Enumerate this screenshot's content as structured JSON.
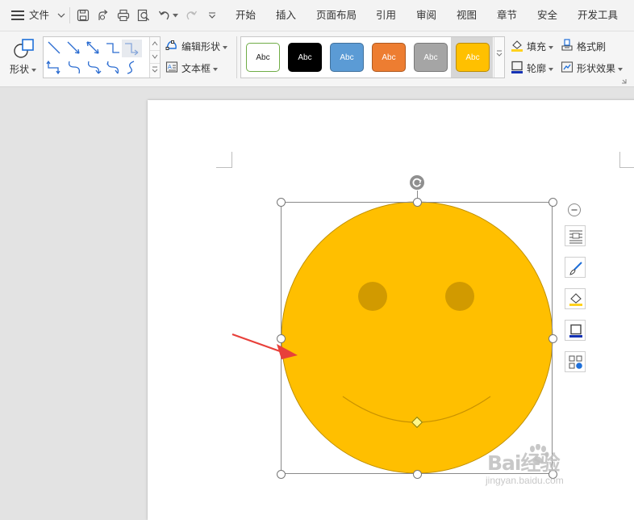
{
  "menubar": {
    "file_label": "文件",
    "tabs": [
      "开始",
      "插入",
      "页面布局",
      "引用",
      "审阅",
      "视图",
      "章节",
      "安全",
      "开发工具"
    ]
  },
  "ribbon": {
    "shapes_label": "形状",
    "edit_shape_label": "编辑形状",
    "text_box_label": "文本框",
    "style_presets": [
      {
        "label": "Abc",
        "fill": "#ffffff",
        "border": "#70ad47",
        "text": "#222222"
      },
      {
        "label": "Abc",
        "fill": "#000000",
        "border": "#000000",
        "text": "#ffffff"
      },
      {
        "label": "Abc",
        "fill": "#5b9bd5",
        "border": "#41719c",
        "text": "#ffffff"
      },
      {
        "label": "Abc",
        "fill": "#ed7d31",
        "border": "#ae5a21",
        "text": "#ffffff"
      },
      {
        "label": "Abc",
        "fill": "#a5a5a5",
        "border": "#787878",
        "text": "#ffffff"
      },
      {
        "label": "Abc",
        "fill": "#ffc000",
        "border": "#bc8c00",
        "text": "#ffffff",
        "selected": true
      }
    ],
    "fill_label": "填充",
    "outline_label": "轮廓",
    "format_painter_label": "格式刷",
    "shape_effects_label": "形状效果"
  },
  "shape": {
    "type": "smiley",
    "fill": "#ffbf00",
    "stroke": "#bf8f00",
    "eye_color": "#d19a00"
  },
  "watermark": {
    "logo_text": "Bai经验",
    "url_text": "jingyan.baidu.com"
  },
  "colors": {
    "accent_red": "#e8403a",
    "selected_preset_bg": "#d6d6d6"
  }
}
